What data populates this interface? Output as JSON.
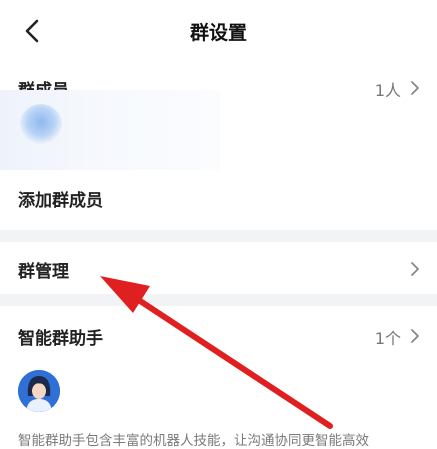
{
  "header": {
    "title": "群设置",
    "back_icon": "chevron-left-icon"
  },
  "members": {
    "label": "群成员",
    "count": "1人"
  },
  "add_member": {
    "label": "添加群成员"
  },
  "manage": {
    "label": "群管理"
  },
  "assistant": {
    "label": "智能群助手",
    "count": "1个",
    "avatar_icon": "assistant-avatar-icon",
    "description": "智能群助手包含丰富的机器人技能，让沟通协同更智能高效"
  },
  "colors": {
    "background": "#ffffff",
    "separator": "#f2f3f5",
    "annotation_arrow": "#e02020"
  }
}
